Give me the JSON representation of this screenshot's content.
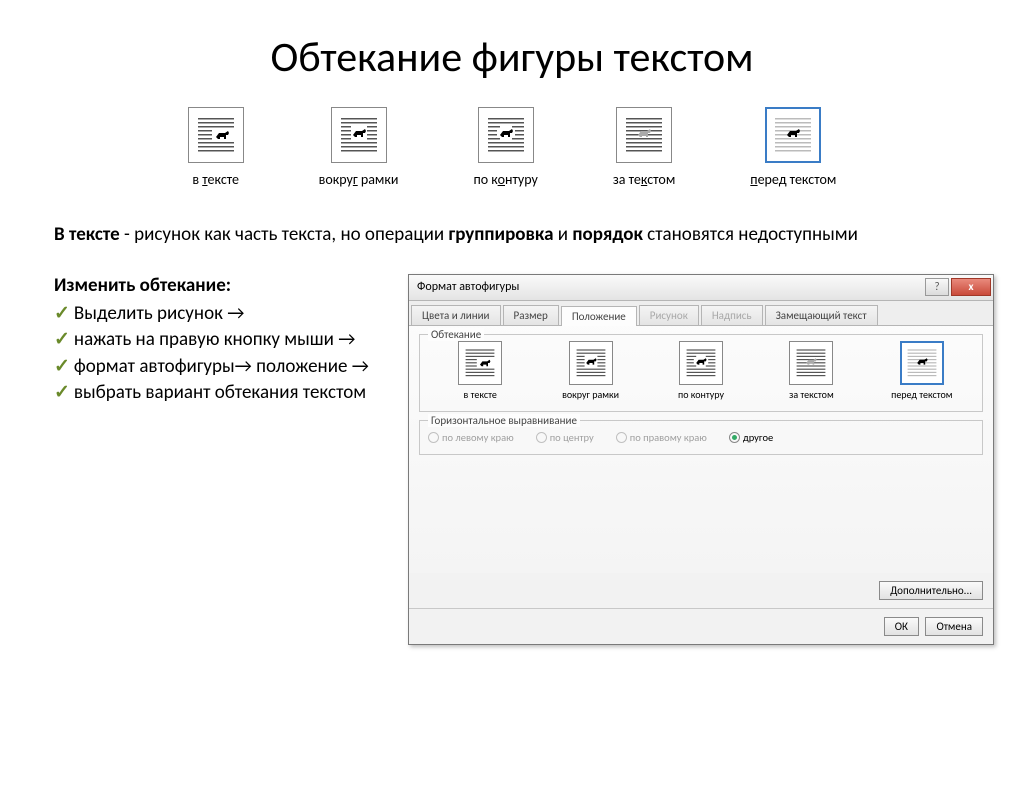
{
  "title": "Обтекание фигуры текстом",
  "wrap_options": [
    {
      "label_pre": "в ",
      "u": "т",
      "label_post": "ексте"
    },
    {
      "label_pre": "вокру",
      "u": "г",
      "label_post": " рамки"
    },
    {
      "label_pre": "по к",
      "u": "о",
      "label_post": "нтуру"
    },
    {
      "label_pre": "за те",
      "u": "к",
      "label_post": "стом"
    },
    {
      "label_pre": "",
      "u": "п",
      "label_post": "еред текстом"
    }
  ],
  "paragraph": {
    "b1": "В тексте",
    "t1": " - рисунок как часть текста, но операции ",
    "b2": "группировка",
    "t2": " и ",
    "b3": "порядок",
    "t3": " становятся недоступными"
  },
  "instructions": {
    "title": "Изменить обтекание:",
    "items": [
      "Выделить рисунок →",
      "нажать на правую кнопку мыши →",
      "формат автофигуры→ положение →",
      "выбрать вариант обтекания текстом"
    ]
  },
  "dialog": {
    "title": "Формат автофигуры",
    "help": "?",
    "close": "x",
    "tabs": [
      "Цвета и линии",
      "Размер",
      "Положение",
      "Рисунок",
      "Надпись",
      "Замещающий текст"
    ],
    "active_tab_index": 2,
    "disabled_tab_indices": [
      3,
      4
    ],
    "group_wrap": "Обтекание",
    "wrap_labels": [
      "в тексте",
      "вокруг рамки",
      "по контуру",
      "за текстом",
      "перед текстом"
    ],
    "group_align": "Горизонтальное выравнивание",
    "align_options": [
      "по левому краю",
      "по центру",
      "по правому краю",
      "другое"
    ],
    "align_checked_index": 3,
    "align_disabled_indices": [
      0,
      1,
      2
    ],
    "more": "Дополнительно...",
    "ok": "ОК",
    "cancel": "Отмена"
  }
}
